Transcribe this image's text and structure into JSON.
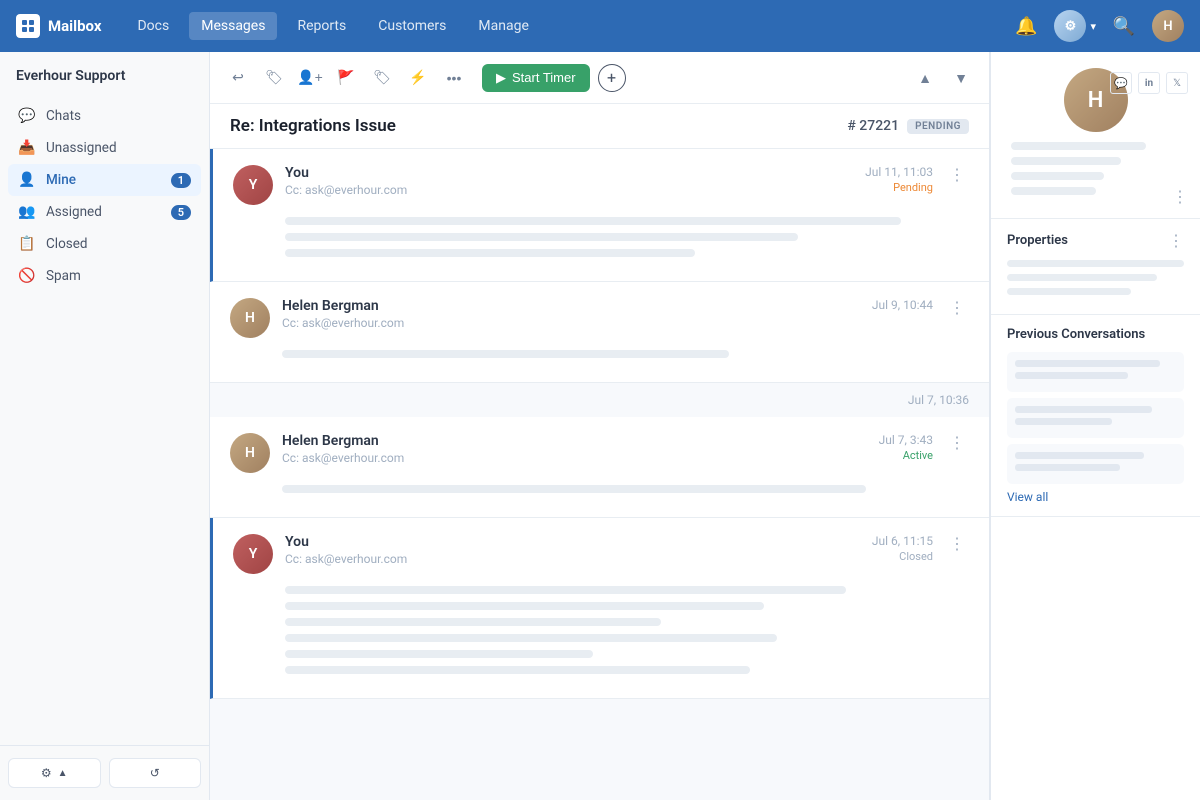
{
  "topnav": {
    "logo": "Mailbox",
    "links": [
      "Docs",
      "Messages",
      "Reports",
      "Customers",
      "Manage"
    ],
    "active_link": "Messages"
  },
  "sidebar": {
    "org_name": "Everhour Support",
    "items": [
      {
        "id": "chats",
        "label": "Chats",
        "icon": "💬",
        "badge": null
      },
      {
        "id": "unassigned",
        "label": "Unassigned",
        "icon": "📥",
        "badge": null
      },
      {
        "id": "mine",
        "label": "Mine",
        "icon": "👤",
        "badge": 1
      },
      {
        "id": "assigned",
        "label": "Assigned",
        "icon": "👥",
        "badge": 5
      },
      {
        "id": "closed",
        "label": "Closed",
        "icon": "📋",
        "badge": null
      },
      {
        "id": "spam",
        "label": "Spam",
        "icon": "🚫",
        "badge": null
      }
    ],
    "active_item": "mine",
    "footer_btn1": "⚙",
    "footer_btn2": "↺"
  },
  "toolbar": {
    "start_timer_label": "Start Timer"
  },
  "conversation": {
    "title": "Re: Integrations Issue",
    "id_label": "# 27221",
    "status_badge": "PENDING"
  },
  "messages": [
    {
      "sender": "You",
      "cc": "Cc: ask@everhour.com",
      "time": "Jul 11, 11:03",
      "status": "Pending",
      "status_type": "pending",
      "lines": [
        90,
        75,
        60
      ],
      "avatar_class": "av-you",
      "avatar_text": "Y",
      "left_accent": true
    },
    {
      "sender": "Helen Bergman",
      "cc": "Cc: ask@everhour.com",
      "time": "Jul 9, 10:44",
      "status": "",
      "status_type": "",
      "lines": [
        65
      ],
      "avatar_class": "av-helen",
      "avatar_text": "H",
      "left_accent": false
    },
    {
      "sender": "Helen Bergman",
      "cc": "Cc: ask@everhour.com",
      "time": "Jul 7, 3:43",
      "status": "Active",
      "status_type": "active",
      "lines": [
        85
      ],
      "avatar_class": "av-helen",
      "avatar_text": "H",
      "left_accent": false,
      "time_sep": "Jul 7, 10:36"
    },
    {
      "sender": "You",
      "cc": "Cc: ask@everhour.com",
      "time": "Jul 6, 11:15",
      "status": "Closed",
      "status_type": "closed",
      "lines": [
        82,
        70,
        55,
        72,
        45,
        68
      ],
      "avatar_class": "av-you",
      "avatar_text": "Y",
      "left_accent": true
    }
  ],
  "right_panel": {
    "contact_initials": "H",
    "properties_title": "Properties",
    "previous_conversations_title": "Previous Conversations",
    "view_all_label": "View all",
    "social_icons": [
      "💬",
      "in",
      "🐦"
    ]
  }
}
